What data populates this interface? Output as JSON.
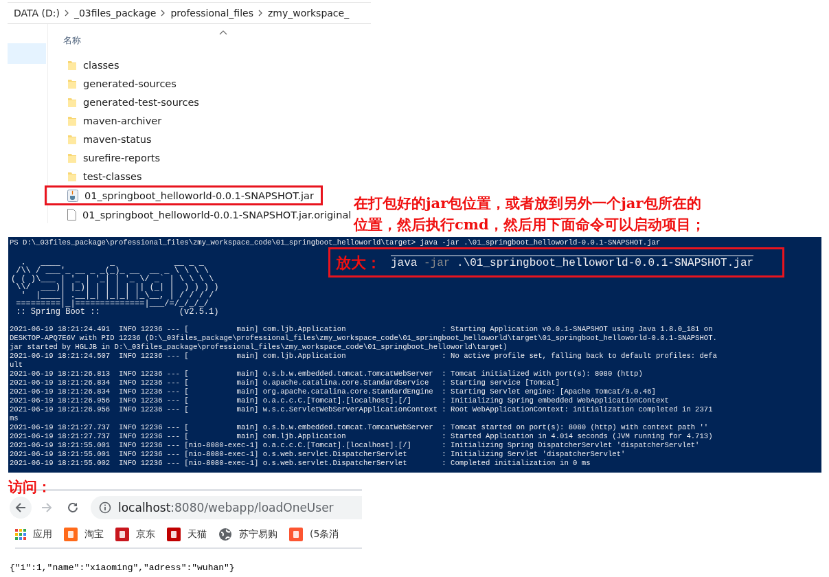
{
  "explorer": {
    "breadcrumb": [
      "DATA (D:)",
      "_03files_package",
      "professional_files",
      "zmy_workspace_"
    ],
    "column_header": "名称",
    "items": [
      {
        "name": "classes",
        "kind": "folder",
        "highlighted": false
      },
      {
        "name": "generated-sources",
        "kind": "folder",
        "highlighted": false
      },
      {
        "name": "generated-test-sources",
        "kind": "folder",
        "highlighted": false
      },
      {
        "name": "maven-archiver",
        "kind": "folder",
        "highlighted": false
      },
      {
        "name": "maven-status",
        "kind": "folder",
        "highlighted": false
      },
      {
        "name": "surefire-reports",
        "kind": "folder",
        "highlighted": false
      },
      {
        "name": "test-classes",
        "kind": "folder",
        "highlighted": false
      },
      {
        "name": "01_springboot_helloworld-0.0.1-SNAPSHOT.jar",
        "kind": "jar",
        "highlighted": true
      },
      {
        "name": "01_springboot_helloworld-0.0.1-SNAPSHOT.jar.original",
        "kind": "file",
        "highlighted": false
      }
    ]
  },
  "note": {
    "lines": [
      "在打包好的jar包位置，或者放到另外一个jar包所在的",
      "位置，然后执行cmd，然后用下面命令可以启动项目；"
    ]
  },
  "terminal": {
    "prompt": "PS D:\\_03files_package\\professional_files\\zmy_workspace_code\\01_springboot_helloworld\\target> java -jar .\\01_springboot_helloworld-0.0.1-SNAPSHOT.jar",
    "banner": [
      "  .   ____          _            __ _ _",
      " /\\\\ / ___'_ __ _ _(_)_ __  __ _ \\ \\ \\ \\",
      "( ( )\\___ | '_ | '_| | '_ \\/ _` | \\ \\ \\ \\",
      " \\\\/  ___)| |_)| | | | | || (_| |  ) ) ) )",
      "  '  |____| .__|_| |_|_| |_\\__, | / / / /",
      " =========|_|==============|___/=/_/_/_/",
      " :: Spring Boot ::                (v2.5.1)"
    ],
    "log_lines": [
      "2021-06-19 18:21:24.491  INFO 12236 --- [           main] com.ljb.Application                      : Starting Application v0.0.1-SNAPSHOT using Java 1.8.0_181 on",
      "DESKTOP-APQ7E6V with PID 12236 (D:\\_03files_package\\professional_files\\zmy_workspace_code\\01_springboot_helloworld\\target\\01_springboot_helloworld-0.0.1-SNAPSHOT.",
      "jar started by HGLJB in D:\\_03files_package\\professional_files\\zmy_workspace_code\\01_springboot_helloworld\\target)",
      "2021-06-19 18:21:24.507  INFO 12236 --- [           main] com.ljb.Application                      : No active profile set, falling back to default profiles: defa",
      "ult",
      "2021-06-19 18:21:26.813  INFO 12236 --- [           main] o.s.b.w.embedded.tomcat.TomcatWebServer  : Tomcat initialized with port(s): 8080 (http)",
      "2021-06-19 18:21:26.834  INFO 12236 --- [           main] o.apache.catalina.core.StandardService   : Starting service [Tomcat]",
      "2021-06-19 18:21:26.834  INFO 12236 --- [           main] org.apache.catalina.core.StandardEngine  : Starting Servlet engine: [Apache Tomcat/9.0.46]",
      "2021-06-19 18:21:26.956  INFO 12236 --- [           main] o.a.c.c.C.[Tomcat].[localhost].[/]       : Initializing Spring embedded WebApplicationContext",
      "2021-06-19 18:21:26.956  INFO 12236 --- [           main] w.s.c.ServletWebServerApplicationContext : Root WebApplicationContext: initialization completed in 2371",
      "ms",
      "2021-06-19 18:21:27.737  INFO 12236 --- [           main] o.s.b.w.embedded.tomcat.TomcatWebServer  : Tomcat started on port(s): 8080 (http) with context path ''",
      "2021-06-19 18:21:27.737  INFO 12236 --- [           main] com.ljb.Application                      : Started Application in 4.014 seconds (JVM running for 4.713)",
      "2021-06-19 18:21:55.001  INFO 12236 --- [nio-8080-exec-1] o.a.c.c.C.[Tomcat].[localhost].[/]       : Initializing Spring DispatcherServlet 'dispatcherServlet'",
      "2021-06-19 18:21:55.001  INFO 12236 --- [nio-8080-exec-1] o.s.web.servlet.DispatcherServlet        : Initializing Servlet 'dispatcherServlet'",
      "2021-06-19 18:21:55.002  INFO 12236 --- [nio-8080-exec-1] o.s.web.servlet.DispatcherServlet        : Completed initialization in 0 ms"
    ],
    "zoom_callout": {
      "label": "放大：",
      "command": "java",
      "flag": "-jar",
      "args": ".\\01_springboot_helloworld-0.0.1-SNAPSHOT.jar"
    }
  },
  "browser": {
    "label": "访问：",
    "forward_disabled": true,
    "url_host": "localhost",
    "url_path": ":8080/webapp/loadOneUser",
    "bookmarks": [
      {
        "label": "应用",
        "kind": "grid",
        "color": "#e8453c"
      },
      {
        "label": "淘宝",
        "kind": "square",
        "color": "#ff6a1a"
      },
      {
        "label": "京东",
        "kind": "square",
        "color": "#c8161d"
      },
      {
        "label": "天猫",
        "kind": "square",
        "color": "#c00000"
      },
      {
        "label": "苏宁易购",
        "kind": "globe",
        "color": "#5f6368"
      },
      {
        "label": "(5条消",
        "kind": "square",
        "color": "#fc5531"
      }
    ],
    "page_text": "{\"i\":1,\"name\":\"xiaoming\",\"adress\":\"wuhan\"}"
  }
}
